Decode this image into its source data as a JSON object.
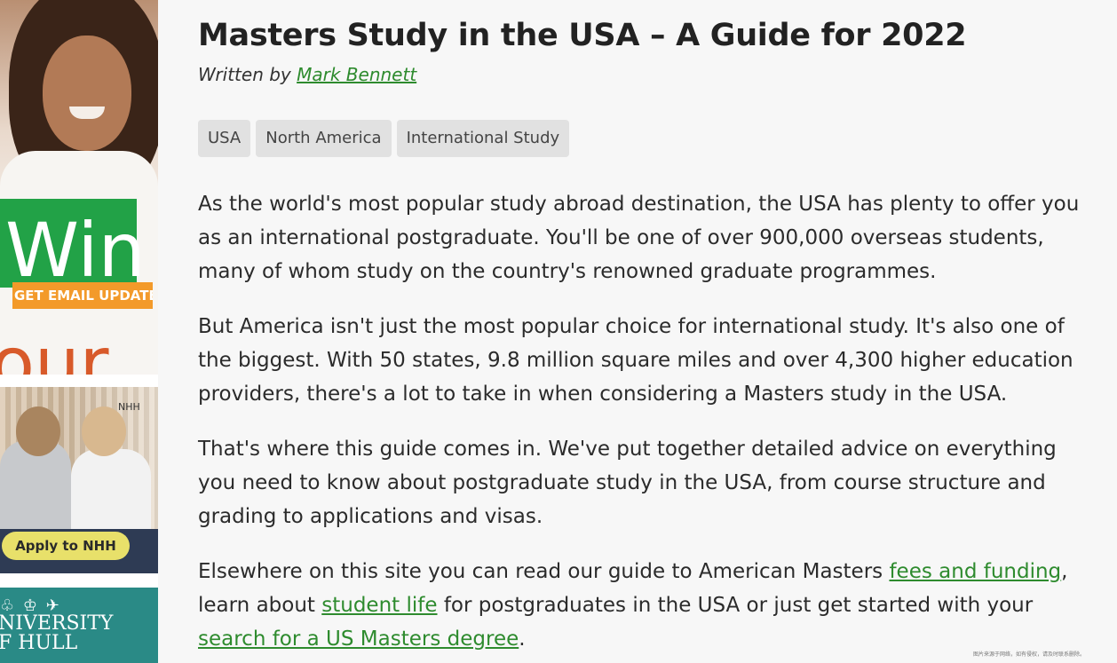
{
  "ads": {
    "ad1": {
      "headline": "Win",
      "headline2": "our",
      "button_label": "GET EMAIL UPDATES"
    },
    "ad2": {
      "brand": "NHH",
      "button_label": "Apply to NHH"
    },
    "ad3": {
      "crest": "♧ ♔ ✈",
      "line1": "NIVERSITY",
      "line2": "F HULL"
    }
  },
  "article": {
    "title": "Masters Study in the USA – A Guide for 2022",
    "byline_prefix": "Written by",
    "author": "Mark Bennett",
    "tags": [
      "USA",
      "North America",
      "International Study"
    ],
    "paragraphs": {
      "p1": {
        "line1": "As the world's most popular study abroad destination, the USA has plenty to offer you",
        "line2": "as an international postgraduate. You'll be one of over 900,000 overseas students,",
        "line3": "many of whom study on the country's renowned graduate programmes."
      },
      "p2": {
        "line1": "But America isn't just the most popular choice for international study. It's also one of",
        "line2": "the biggest. With 50 states, 9.8 million square miles and over 4,300 higher education",
        "line3": "providers, there's a lot to take in when considering a Masters study in the USA."
      },
      "p3": {
        "line1": "That's where this guide comes in. We've put together detailed advice on everything",
        "line2": "you need to know about postgraduate study in the USA, from course structure and",
        "line3": "grading to applications and visas."
      },
      "p4": {
        "text1": "Elsewhere on this site you can read our guide to American Masters ",
        "link1": "fees and funding",
        "text2": ",",
        "text3": "learn about ",
        "link2": "student life",
        "text4": " for postgraduates in the USA or just get started with your",
        "link3": "search for a US Masters degree",
        "text5": "."
      }
    }
  },
  "watermark": "图片来源于网络，如有侵权，请及时联系删除。",
  "colors": {
    "link": "#2e8b2e",
    "ad_green": "#22a247",
    "ad_orange": "#f39a2a",
    "tag_bg": "#e1e1e1"
  }
}
